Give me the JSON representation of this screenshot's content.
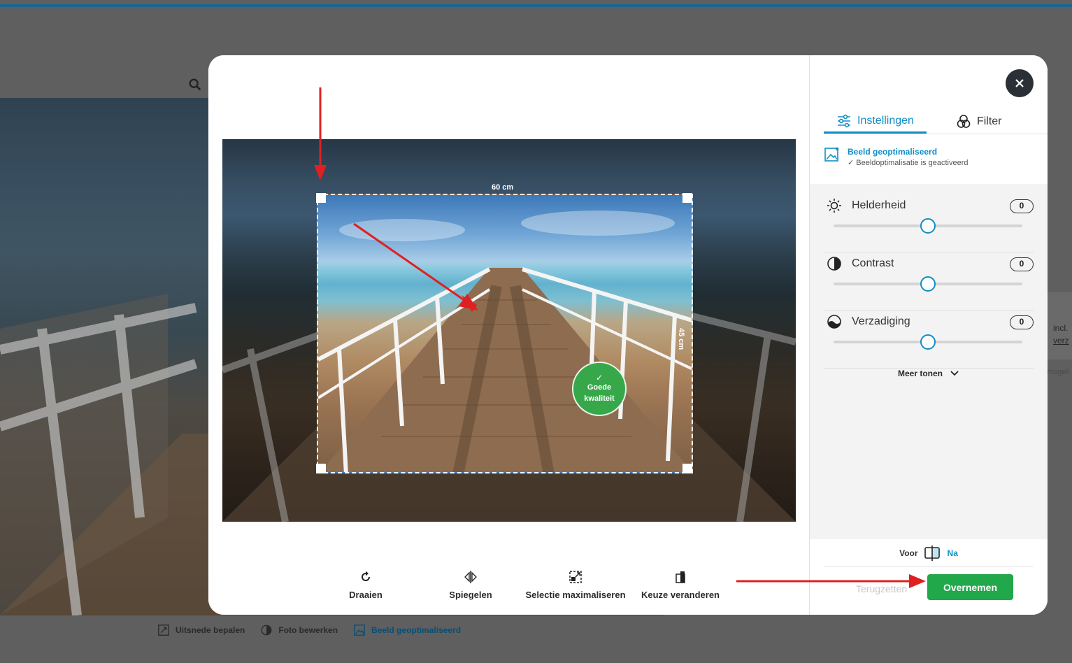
{
  "background": {
    "search_icon": "search-icon",
    "side_texts": [
      "incl.",
      "verz"
    ],
    "side_text_mogeli": "mogeli",
    "tools": [
      {
        "icon": "crop-icon",
        "label": "Uitsnede bepalen",
        "active": false
      },
      {
        "icon": "contrast-icon",
        "label": "Foto bewerken",
        "active": false
      },
      {
        "icon": "image-optimize-icon",
        "label": "Beeld geoptimaliseerd",
        "active": true
      }
    ]
  },
  "editor": {
    "crop": {
      "width_label": "60 cm",
      "height_label": "45 cm",
      "quality_label": "Goede kwaliteit"
    },
    "toolbar": [
      {
        "icon": "rotate-icon",
        "label": "Draaien"
      },
      {
        "icon": "mirror-icon",
        "label": "Spiegelen"
      },
      {
        "icon": "maximize-selection-icon",
        "label": "Selectie maximaliseren"
      },
      {
        "icon": "change-choice-icon",
        "label": "Keuze veranderen"
      }
    ]
  },
  "panel": {
    "close_icon": "close-icon",
    "tabs": [
      {
        "icon": "sliders-icon",
        "label": "Instellingen",
        "active": true
      },
      {
        "icon": "filter-icon",
        "label": "Filter",
        "active": false
      }
    ],
    "optimized": {
      "title": "Beeld geoptimaliseerd",
      "subtitle": "✓ Beeldoptimalisatie is geactiveerd"
    },
    "adjustments": [
      {
        "icon": "brightness-icon",
        "label": "Helderheid",
        "value": "0",
        "level": 0.5
      },
      {
        "icon": "contrast-icon",
        "label": "Contrast",
        "value": "0",
        "level": 0.5
      },
      {
        "icon": "saturation-icon",
        "label": "Verzadiging",
        "value": "0",
        "level": 0.5
      }
    ],
    "more_label": "Meer tonen",
    "compare": {
      "before": "Voor",
      "after": "Na"
    },
    "reset_label": "Terugzetten",
    "apply_label": "Overnemen"
  },
  "colors": {
    "accent": "#0f8fc4",
    "apply_green": "#21a84a",
    "quality_green": "#37a84a",
    "annotation_red": "#e02020"
  }
}
